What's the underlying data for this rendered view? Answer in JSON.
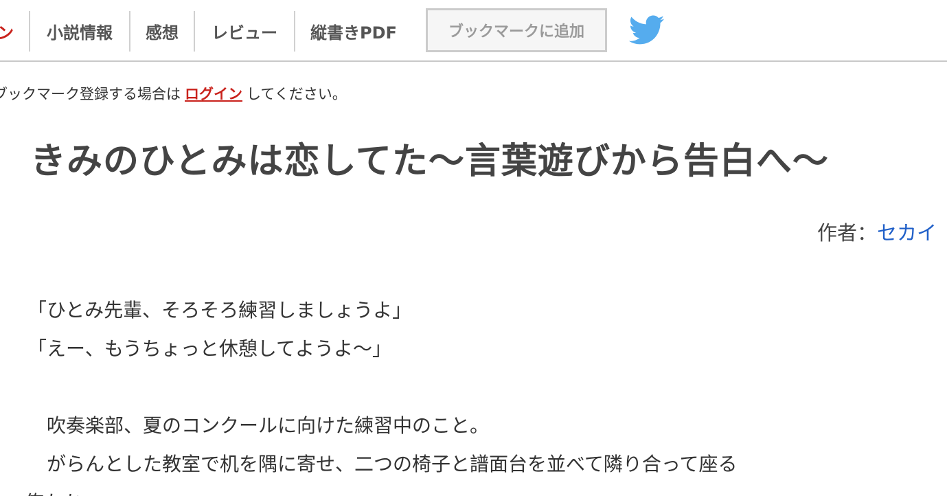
{
  "nav": {
    "login_fragment": "ン",
    "items": [
      "小説情報",
      "感想",
      "レビュー",
      "縦書きPDF"
    ],
    "bookmark_label": "ブックマークに追加",
    "twitter_icon": "twitter-bird-icon",
    "twitter_color": "#55acee"
  },
  "notice": {
    "prefix": "ブックマーク登録する場合は",
    "link": "ログイン",
    "suffix": "してください。"
  },
  "novel": {
    "title": "きみのひとみは恋してた〜言葉遊びから告白へ〜",
    "author_label": "作者：",
    "author_name": "セカイ"
  },
  "text": {
    "lines": [
      "「ひとみ先輩、そろそろ練習しましょうよ」",
      "「えー、もうちょっと休憩してようよ〜」",
      "",
      "　吹奏楽部、夏のコンクールに向けた練習中のこと。",
      "　がらんとした教室で机を隅に寄せ、二つの椅子と譜面台を並べて隣り合って座る",
      "俺たち"
    ]
  },
  "colors": {
    "accent_red": "#c9221c",
    "link_blue": "#1f5fc8"
  }
}
